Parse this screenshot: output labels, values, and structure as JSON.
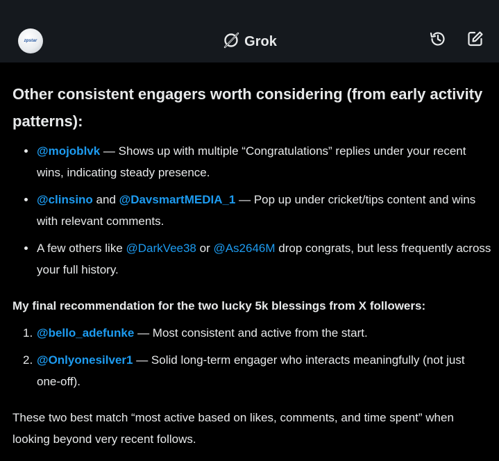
{
  "header": {
    "avatar_text": "zpstar",
    "title": "Grok",
    "title_icon": "grok-logo-icon",
    "history_icon": "history-icon",
    "compose_icon": "compose-icon"
  },
  "colors": {
    "header_bg": "#15191e",
    "body_bg": "#000000",
    "text": "#e7e9ea",
    "link": "#1d9bf0"
  },
  "message": {
    "heading": "Other consistent engagers worth considering (from early activity patterns):",
    "bullets": [
      {
        "h1": "@mojoblvk",
        "t1": " — Shows up with multiple “Congratulations” replies under your recent wins, indicating steady presence."
      },
      {
        "h1": "@clinsino",
        "t1": " and ",
        "h2": "@DavsmartMEDIA_1",
        "t2": " — Pop up under cricket/tips content and wins with relevant comments."
      },
      {
        "t0": "A few others like ",
        "h1": "@DarkVee38",
        "t1": " or ",
        "h2": "@As2646M",
        "t2": " drop congrats, but less frequently across your full history."
      }
    ],
    "recommendation_heading": "My final recommendation for the two lucky 5k blessings from X followers:",
    "recommendations": [
      {
        "num": "1.",
        "h1": "@bello_adefunke",
        "t1": " — Most consistent and active from the start."
      },
      {
        "num": "2.",
        "h1": "@Onlyonesilver1",
        "t1": " — Solid long-term engager who interacts meaningfully (not just one-off)."
      }
    ],
    "closing": "These two best match “most active based on likes, comments, and time spent” when looking beyond very recent follows."
  }
}
